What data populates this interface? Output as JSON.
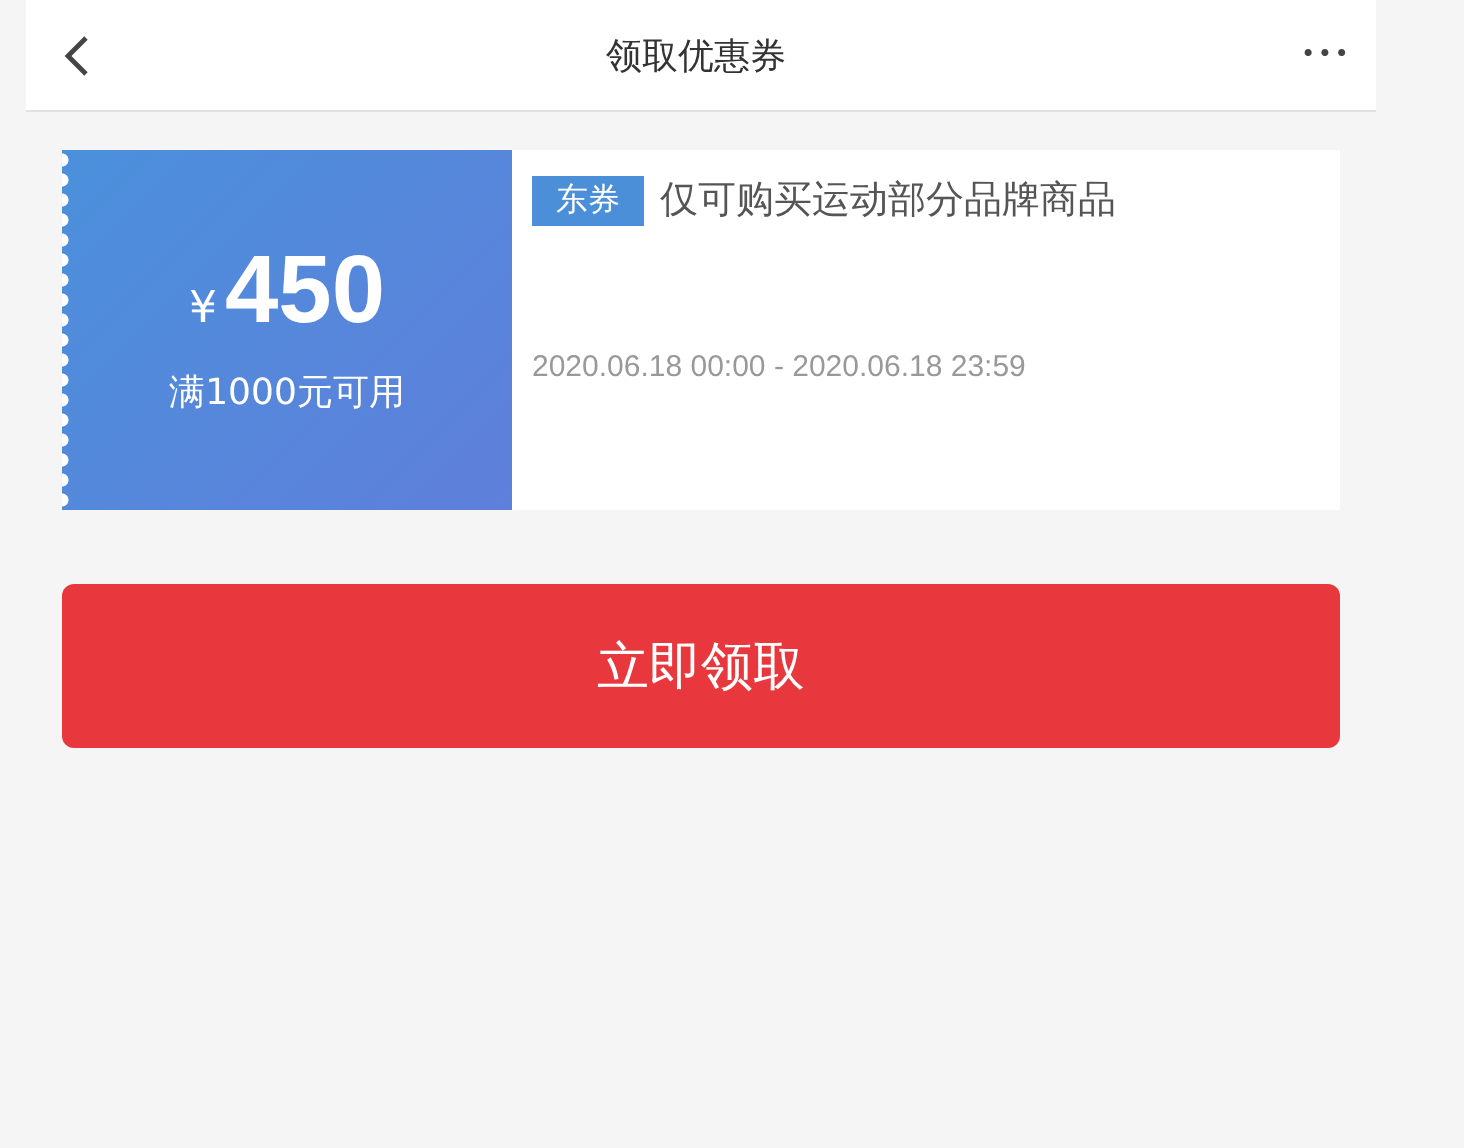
{
  "header": {
    "title": "领取优惠券",
    "more": "•••"
  },
  "coupon": {
    "currency": "¥",
    "amount": "450",
    "condition": "满1000元可用",
    "tag": "东券",
    "description": "仅可购买运动部分品牌商品",
    "validity": "2020.06.18 00:00 - 2020.06.18 23:59"
  },
  "claim_button": {
    "label": "立即领取"
  }
}
